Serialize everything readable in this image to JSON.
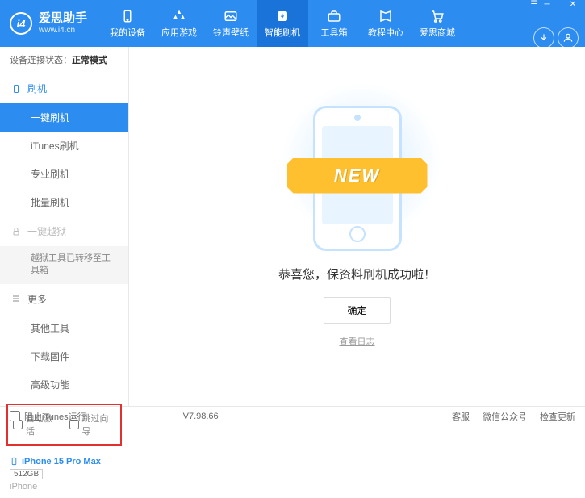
{
  "header": {
    "logo_title": "爱思助手",
    "logo_sub": "www.i4.cn",
    "nav": [
      {
        "label": "我的设备"
      },
      {
        "label": "应用游戏"
      },
      {
        "label": "铃声壁纸"
      },
      {
        "label": "智能刷机"
      },
      {
        "label": "工具箱"
      },
      {
        "label": "教程中心"
      },
      {
        "label": "爱思商城"
      }
    ]
  },
  "sidebar": {
    "status_label": "设备连接状态：",
    "status_value": "正常模式",
    "section_flash": "刷机",
    "items_flash": [
      "一键刷机",
      "iTunes刷机",
      "专业刷机",
      "批量刷机"
    ],
    "section_jailbreak": "一键越狱",
    "jailbreak_note": "越狱工具已转移至工具箱",
    "section_more": "更多",
    "items_more": [
      "其他工具",
      "下载固件",
      "高级功能"
    ],
    "checkbox_auto": "自动激活",
    "checkbox_skip": "跳过向导",
    "device_name": "iPhone 15 Pro Max",
    "device_storage": "512GB",
    "device_type": "iPhone"
  },
  "main": {
    "ribbon": "NEW",
    "success": "恭喜您，保资料刷机成功啦！",
    "ok": "确定",
    "log": "查看日志"
  },
  "footer": {
    "block_itunes": "阻止iTunes运行",
    "version": "V7.98.66",
    "links": [
      "客服",
      "微信公众号",
      "检查更新"
    ]
  }
}
